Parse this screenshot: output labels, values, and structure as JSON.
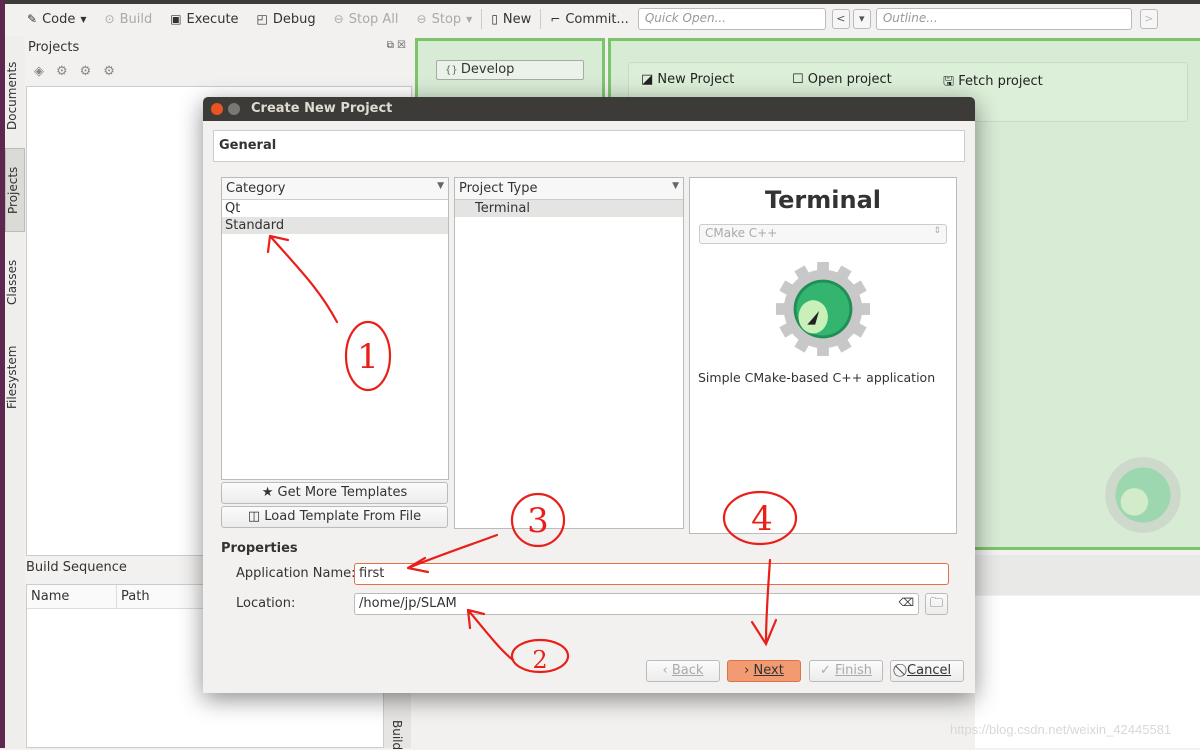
{
  "toolbar": {
    "code": "Code",
    "build": "Build",
    "execute": "Execute",
    "debug": "Debug",
    "stop_all": "Stop All",
    "stop": "Stop",
    "new": "New",
    "commit": "Commit...",
    "quick_open_placeholder": "Quick Open...",
    "outline_placeholder": "Outline..."
  },
  "side_tabs": [
    "Documents",
    "Projects",
    "Classes",
    "Filesystem"
  ],
  "projects_panel": {
    "title": "Projects"
  },
  "build_sequence": {
    "title": "Build Sequence",
    "columns": [
      "Name",
      "Path"
    ],
    "side_tab": "Build"
  },
  "session": {
    "develop": "Develop",
    "new_project": "New Project",
    "open_project": "Open project",
    "fetch_project": "Fetch project"
  },
  "dialog": {
    "title": "Create New Project",
    "section": "General",
    "category": {
      "header": "Category",
      "items": [
        "Qt",
        "Standard"
      ],
      "selected": "Standard"
    },
    "project_type": {
      "header": "Project Type",
      "items": [
        "Terminal"
      ]
    },
    "get_more": "Get More Templates",
    "load_template": "Load Template From File",
    "preview": {
      "title": "Terminal",
      "build_system": "CMake C++",
      "description": "Simple CMake-based C++ application"
    },
    "properties": {
      "title": "Properties",
      "app_name_label": "Application Name:",
      "app_name_value": "first",
      "location_label": "Location:",
      "location_value": "/home/jp/SLAM"
    },
    "buttons": {
      "back": "Back",
      "next": "Next",
      "finish": "Finish",
      "cancel": "Cancel"
    }
  },
  "annotations": [
    "1",
    "2",
    "3",
    "4"
  ],
  "watermark": "https://blog.csdn.net/weixin_42445581",
  "colors": {
    "accent_next": "#f08a5d",
    "green_border": "#7cc46c",
    "annotation": "#e8201a"
  }
}
